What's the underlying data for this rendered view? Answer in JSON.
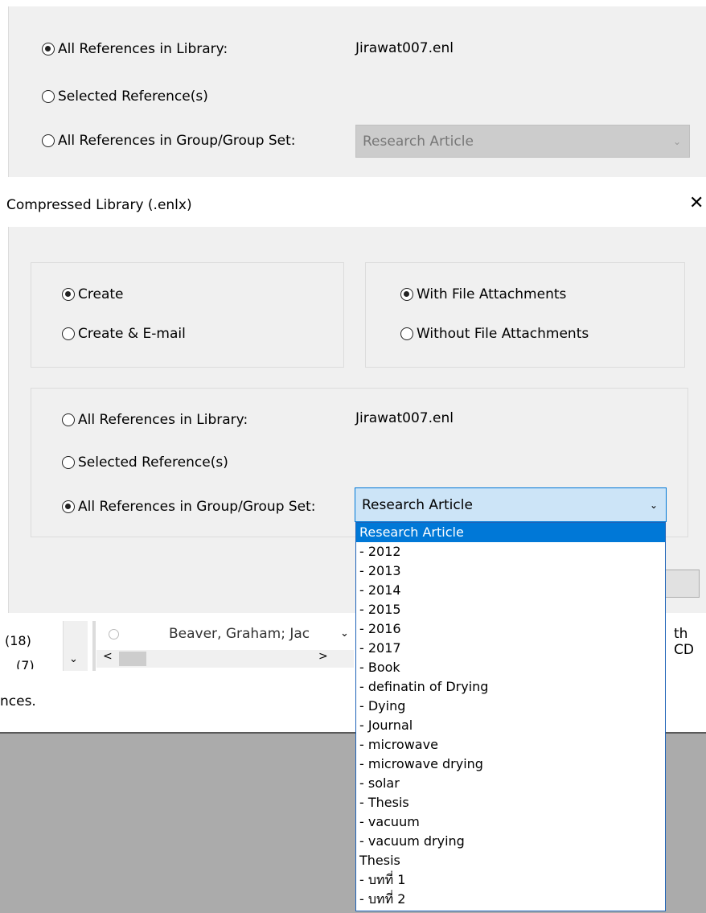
{
  "top_panel": {
    "scope": {
      "all_refs_label": "All References in Library:",
      "library_name": "Jirawat007.enl",
      "selected_label": "Selected Reference(s)",
      "group_label": "All References in Group/Group Set:",
      "group_value": "Research Article"
    }
  },
  "dialog": {
    "title": "Compressed Library (.enlx)",
    "close_glyph": "✕",
    "action": {
      "create_label": "Create",
      "create_email_label": "Create & E-mail"
    },
    "attachments": {
      "with_label": "With File Attachments",
      "without_label": "Without File Attachments"
    },
    "scope": {
      "all_refs_label": "All References in Library:",
      "library_name": "Jirawat007.enl",
      "selected_label": "Selected Reference(s)",
      "group_label": "All References in Group/Group Set:",
      "group_value": "Research Article"
    },
    "dropdown_items": [
      "Research Article",
      "- 2012",
      "- 2013",
      "- 2014",
      "- 2015",
      "- 2016",
      "- 2017",
      "- Book",
      "- definatin of Drying",
      "- Dying",
      "- Journal",
      "- microwave",
      "- microwave drying",
      "- solar",
      "- Thesis",
      "- vacuum",
      "- vacuum drying",
      "Thesis",
      "- บทที่ 1",
      "- บทที่ 2"
    ]
  },
  "background": {
    "count_18": "(18)",
    "count_7": "(7)",
    "ref_author": "Beaver, Graham; Jac",
    "ref_tail": "th CD",
    "status_text": "nces.",
    "scroll_left": "<",
    "scroll_right": ">"
  },
  "colors": {
    "accent": "#0078d7",
    "panel_bg": "#f0f0f0",
    "desktop_bg": "#ababab"
  }
}
